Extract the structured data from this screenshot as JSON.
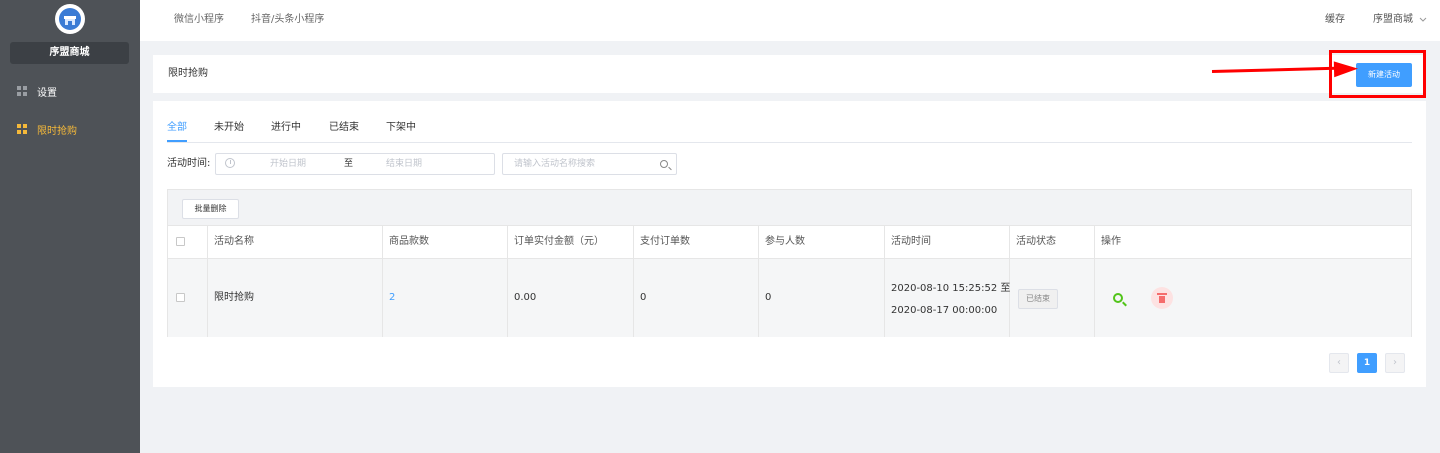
{
  "sidebar": {
    "store_name": "序盟商城",
    "items": [
      {
        "label": "设置",
        "active": false
      },
      {
        "label": "限时抢购",
        "active": true
      }
    ]
  },
  "topbar": {
    "tabs": [
      "微信小程序",
      "抖音/头条小程序"
    ],
    "cache_label": "缓存",
    "store_menu": "序盟商城",
    "store_menu_icon": "chevron-down-icon"
  },
  "header": {
    "title": "限时抢购",
    "new_button": "新建活动"
  },
  "status_tabs": [
    {
      "label": "全部",
      "active": true
    },
    {
      "label": "未开始",
      "active": false
    },
    {
      "label": "进行中",
      "active": false
    },
    {
      "label": "已结束",
      "active": false
    },
    {
      "label": "下架中",
      "active": false
    }
  ],
  "filters": {
    "time_label": "活动时间:",
    "start_placeholder": "开始日期",
    "separator": "至",
    "end_placeholder": "结束日期",
    "search_placeholder": "请输入活动名称搜索"
  },
  "table": {
    "batch_delete": "批量删除",
    "columns": [
      "活动名称",
      "商品款数",
      "订单实付金额（元）",
      "支付订单数",
      "参与人数",
      "活动时间",
      "活动状态",
      "操作"
    ],
    "rows": [
      {
        "name": "限时抢购",
        "product_count": "2",
        "paid_amount": "0.00",
        "paid_orders": "0",
        "participants": "0",
        "time_start": "2020-08-10 15:25:52 至",
        "time_end": "2020-08-17 00:00:00",
        "status": "已结束"
      }
    ]
  },
  "pagination": {
    "prev": "‹",
    "current": "1",
    "next": "›"
  },
  "colors": {
    "primary": "#409eff",
    "sidebar_bg": "#4e5257",
    "sidebar_active": "#f5b93a",
    "annotation": "#ff0000",
    "view_icon": "#52c41a",
    "delete_icon": "#f56c6c"
  }
}
